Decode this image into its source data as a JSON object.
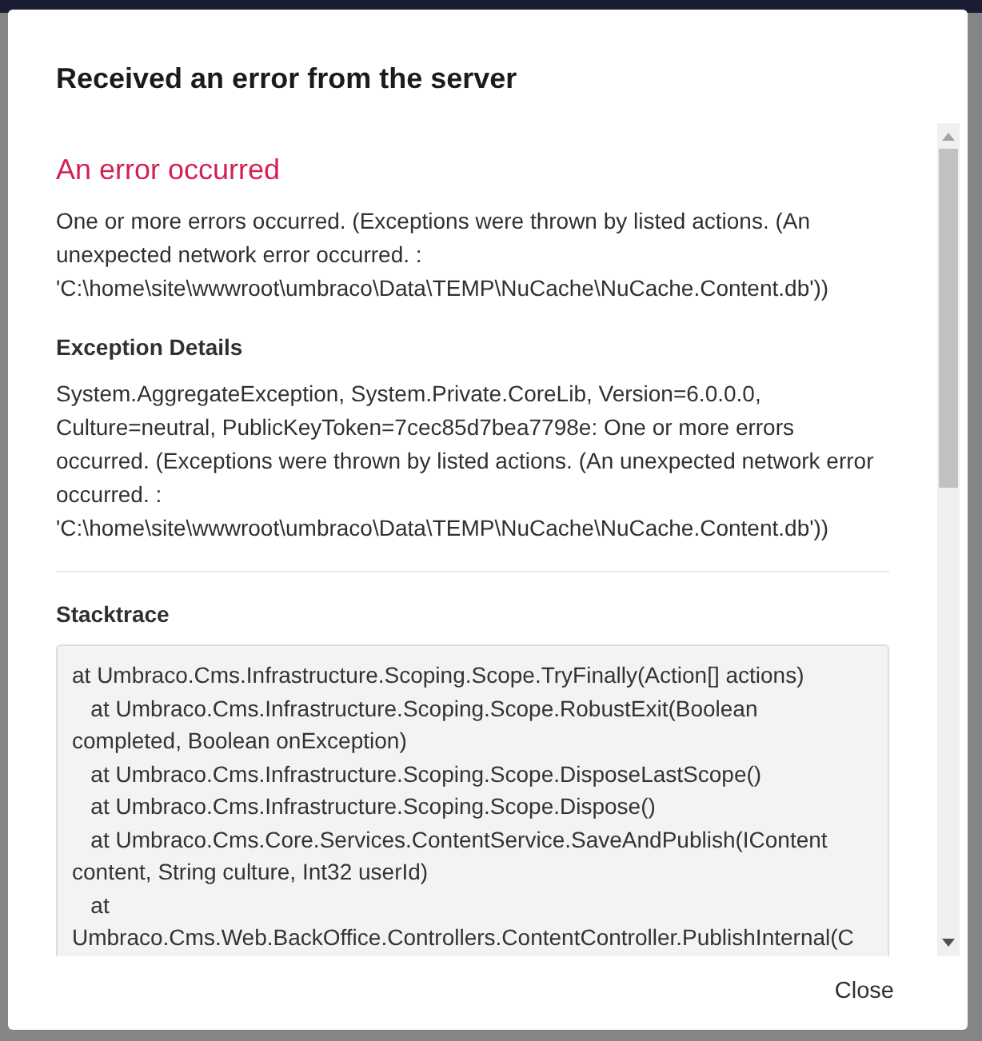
{
  "dialog": {
    "title": "Received an error from the server",
    "error_heading": "An error occurred",
    "error_message": "One or more errors occurred. (Exceptions were thrown by listed actions. (An unexpected network error occurred. : 'C:\\home\\site\\wwwroot\\umbraco\\Data\\TEMP\\NuCache\\NuCache.Content.db'))",
    "sections": [
      {
        "heading": "Exception Details",
        "kind": "text",
        "text": "System.AggregateException, System.Private.CoreLib, Version=6.0.0.0, Culture=neutral, PublicKeyToken=7cec85d7bea7798e: One or more errors occurred. (Exceptions were thrown by listed actions. (An unexpected network error occurred. : 'C:\\home\\site\\wwwroot\\umbraco\\Data\\TEMP\\NuCache\\NuCache.Content.db'))"
      },
      {
        "heading": "Stacktrace",
        "kind": "trace",
        "lines": [
          "at Umbraco.Cms.Infrastructure.Scoping.Scope.TryFinally(Action[] actions)",
          "   at Umbraco.Cms.Infrastructure.Scoping.Scope.RobustExit(Boolean completed, Boolean onException)",
          "   at Umbraco.Cms.Infrastructure.Scoping.Scope.DisposeLastScope()",
          "   at Umbraco.Cms.Infrastructure.Scoping.Scope.Dispose()",
          "   at Umbraco.Cms.Core.Services.ContentService.SaveAndPublish(IContent content, String culture, Int32 userId)",
          "   at",
          "Umbraco.Cms.Web.BackOffice.Controllers.ContentController.PublishInternal(C"
        ]
      }
    ],
    "buttons": [
      "Close"
    ]
  }
}
